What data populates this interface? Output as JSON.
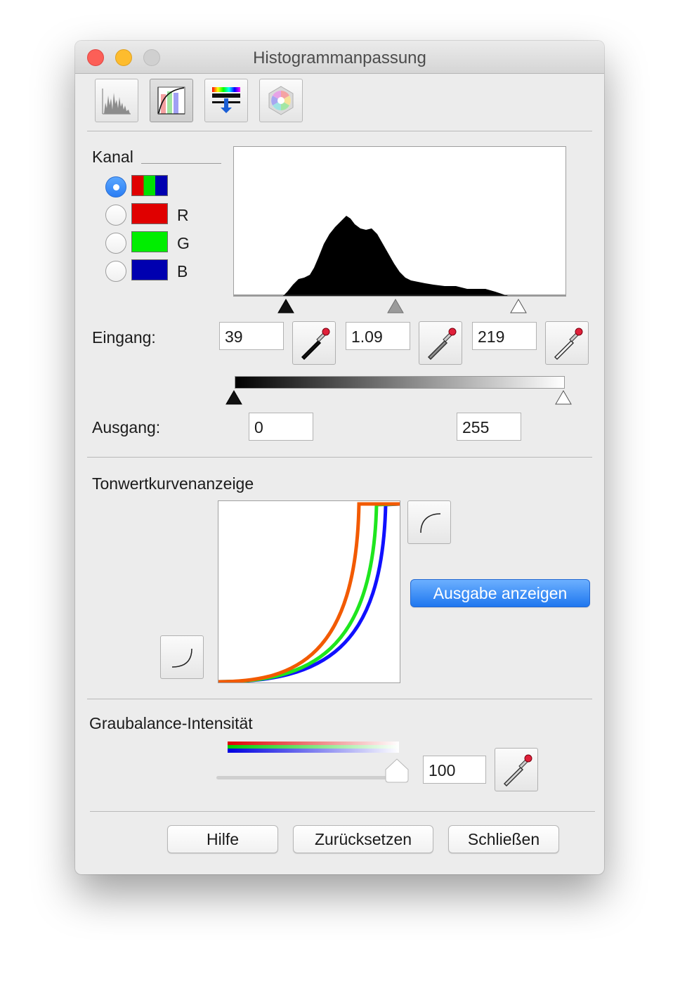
{
  "window": {
    "title": "Histogrammanpassung"
  },
  "toolbar": {
    "buttons": [
      {
        "name": "histogram-tool",
        "active": false
      },
      {
        "name": "tone-curve-tool",
        "active": true
      },
      {
        "name": "color-balance-tool",
        "active": false
      },
      {
        "name": "color-wheel-tool",
        "active": false
      }
    ]
  },
  "channel": {
    "label": "Kanal",
    "options": [
      {
        "label": "",
        "selected": true,
        "colors": [
          "#e00000",
          "#00e000",
          "#0000b0"
        ]
      },
      {
        "label": "R",
        "selected": false,
        "colors": [
          "#e00000"
        ]
      },
      {
        "label": "G",
        "selected": false,
        "colors": [
          "#00ee00"
        ]
      },
      {
        "label": "B",
        "selected": false,
        "colors": [
          "#0000b0"
        ]
      }
    ]
  },
  "input": {
    "label": "Eingang:",
    "black_value": "39",
    "gamma_value": "1.09",
    "white_value": "219"
  },
  "output": {
    "label": "Ausgang:",
    "min_value": "0",
    "max_value": "255"
  },
  "tone_curve": {
    "label": "Tonwertkurvenanzeige",
    "show_output_button": "Ausgabe anzeigen"
  },
  "gray_balance": {
    "label": "Graubalance-Intensität",
    "value": "100",
    "level": 1.0
  },
  "footer": {
    "help_label": "Hilfe",
    "reset_label": "Zurücksetzen",
    "close_label": "Schließen"
  },
  "colors": {
    "accent": "#2a7df4",
    "curve_red": "#f25a00",
    "curve_green": "#1ee61e",
    "curve_blue": "#1010ff"
  }
}
